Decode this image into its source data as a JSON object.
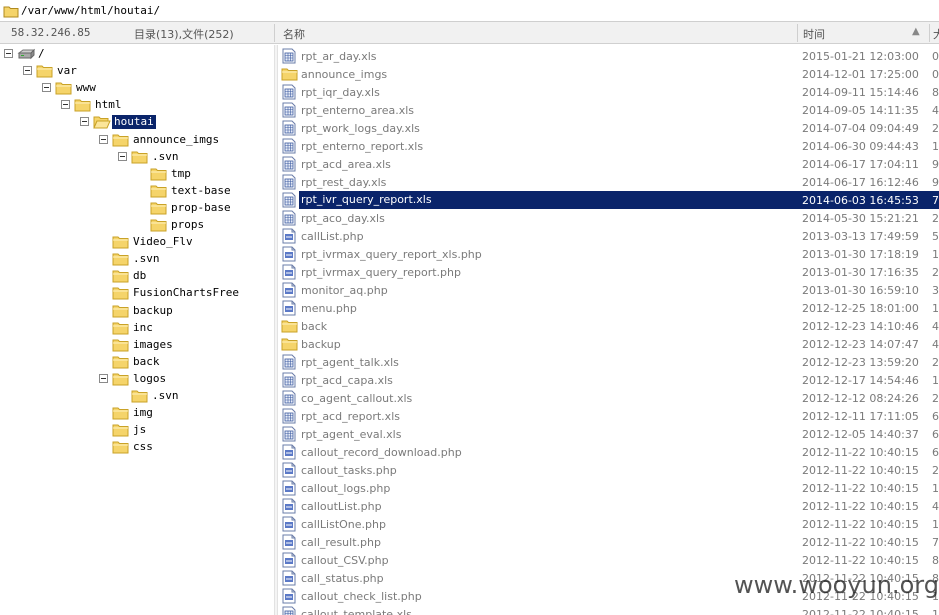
{
  "address_bar": {
    "path": "/var/www/html/houtai/"
  },
  "header": {
    "ip": "58.32.246.85",
    "counts": "目录(13),文件(252)",
    "col_name": "名称",
    "col_time": "时间",
    "col_size": "大"
  },
  "tree": [
    {
      "label": "/",
      "icon": "drive-icon",
      "depth": 0,
      "expanded": true
    },
    {
      "label": "var",
      "icon": "folder-icon",
      "depth": 1,
      "expanded": true
    },
    {
      "label": "www",
      "icon": "folder-icon",
      "depth": 2,
      "expanded": true
    },
    {
      "label": "html",
      "icon": "folder-icon",
      "depth": 3,
      "expanded": true
    },
    {
      "label": "houtai",
      "icon": "folder-open-icon",
      "depth": 4,
      "expanded": true,
      "selected": true
    },
    {
      "label": "announce_imgs",
      "icon": "folder-icon",
      "depth": 5,
      "expanded": true
    },
    {
      "label": ".svn",
      "icon": "folder-icon",
      "depth": 6,
      "expanded": true
    },
    {
      "label": "tmp",
      "icon": "folder-icon",
      "depth": 7
    },
    {
      "label": "text-base",
      "icon": "folder-icon",
      "depth": 7
    },
    {
      "label": "prop-base",
      "icon": "folder-icon",
      "depth": 7
    },
    {
      "label": "props",
      "icon": "folder-icon",
      "depth": 7
    },
    {
      "label": "Video_Flv",
      "icon": "folder-icon",
      "depth": 5
    },
    {
      "label": ".svn",
      "icon": "folder-icon",
      "depth": 5
    },
    {
      "label": "db",
      "icon": "folder-icon",
      "depth": 5
    },
    {
      "label": "FusionChartsFree",
      "icon": "folder-icon",
      "depth": 5
    },
    {
      "label": "backup",
      "icon": "folder-icon",
      "depth": 5
    },
    {
      "label": "inc",
      "icon": "folder-icon",
      "depth": 5
    },
    {
      "label": "images",
      "icon": "folder-icon",
      "depth": 5
    },
    {
      "label": "back",
      "icon": "folder-icon",
      "depth": 5
    },
    {
      "label": "logos",
      "icon": "folder-icon",
      "depth": 5,
      "expanded": true
    },
    {
      "label": ".svn",
      "icon": "folder-icon",
      "depth": 6
    },
    {
      "label": "img",
      "icon": "folder-icon",
      "depth": 5
    },
    {
      "label": "js",
      "icon": "folder-icon",
      "depth": 5
    },
    {
      "label": "css",
      "icon": "folder-icon",
      "depth": 5
    }
  ],
  "files": [
    {
      "name": "rpt_ar_day.xls",
      "time": "2015-01-21 12:03:00",
      "size": "0",
      "icon": "xls-file-icon"
    },
    {
      "name": "announce_imgs",
      "time": "2014-12-01 17:25:00",
      "size": "0",
      "icon": "folder-icon"
    },
    {
      "name": "rpt_iqr_day.xls",
      "time": "2014-09-11 15:14:46",
      "size": "8",
      "icon": "xls-file-icon"
    },
    {
      "name": "rpt_enterno_area.xls",
      "time": "2014-09-05 14:11:35",
      "size": "4",
      "icon": "xls-file-icon"
    },
    {
      "name": "rpt_work_logs_day.xls",
      "time": "2014-07-04 09:04:49",
      "size": "2",
      "icon": "xls-file-icon"
    },
    {
      "name": "rpt_enterno_report.xls",
      "time": "2014-06-30 09:44:43",
      "size": "1",
      "icon": "xls-file-icon"
    },
    {
      "name": "rpt_acd_area.xls",
      "time": "2014-06-17 17:04:11",
      "size": "9",
      "icon": "xls-file-icon"
    },
    {
      "name": "rpt_rest_day.xls",
      "time": "2014-06-17 16:12:46",
      "size": "9",
      "icon": "xls-file-icon"
    },
    {
      "name": "rpt_ivr_query_report.xls",
      "time": "2014-06-03 16:45:53",
      "size": "7",
      "icon": "xls-file-icon",
      "selected": true
    },
    {
      "name": "rpt_aco_day.xls",
      "time": "2014-05-30 15:21:21",
      "size": "2",
      "icon": "xls-file-icon"
    },
    {
      "name": "callList.php",
      "time": "2013-03-13 17:49:59",
      "size": "5",
      "icon": "php-file-icon"
    },
    {
      "name": "rpt_ivrmax_query_report_xls.php",
      "time": "2013-01-30 17:18:19",
      "size": "1",
      "icon": "php-file-icon"
    },
    {
      "name": "rpt_ivrmax_query_report.php",
      "time": "2013-01-30 17:16:35",
      "size": "2",
      "icon": "php-file-icon"
    },
    {
      "name": "monitor_aq.php",
      "time": "2013-01-30 16:59:10",
      "size": "3",
      "icon": "php-file-icon"
    },
    {
      "name": "menu.php",
      "time": "2012-12-25 18:01:00",
      "size": "1",
      "icon": "php-file-icon"
    },
    {
      "name": "back",
      "time": "2012-12-23 14:10:46",
      "size": "4",
      "icon": "folder-icon"
    },
    {
      "name": "backup",
      "time": "2012-12-23 14:07:47",
      "size": "4",
      "icon": "folder-icon"
    },
    {
      "name": "rpt_agent_talk.xls",
      "time": "2012-12-23 13:59:20",
      "size": "2",
      "icon": "xls-file-icon"
    },
    {
      "name": "rpt_acd_capa.xls",
      "time": "2012-12-17 14:54:46",
      "size": "1",
      "icon": "xls-file-icon"
    },
    {
      "name": "co_agent_callout.xls",
      "time": "2012-12-12 08:24:26",
      "size": "2",
      "icon": "xls-file-icon"
    },
    {
      "name": "rpt_acd_report.xls",
      "time": "2012-12-11 17:11:05",
      "size": "6",
      "icon": "xls-file-icon"
    },
    {
      "name": "rpt_agent_eval.xls",
      "time": "2012-12-05 14:40:37",
      "size": "6",
      "icon": "xls-file-icon"
    },
    {
      "name": "callout_record_download.php",
      "time": "2012-11-22 10:40:15",
      "size": "6",
      "icon": "php-file-icon"
    },
    {
      "name": "callout_tasks.php",
      "time": "2012-11-22 10:40:15",
      "size": "2",
      "icon": "php-file-icon"
    },
    {
      "name": "callout_logs.php",
      "time": "2012-11-22 10:40:15",
      "size": "1",
      "icon": "php-file-icon"
    },
    {
      "name": "calloutList.php",
      "time": "2012-11-22 10:40:15",
      "size": "4",
      "icon": "php-file-icon"
    },
    {
      "name": "callListOne.php",
      "time": "2012-11-22 10:40:15",
      "size": "1",
      "icon": "php-file-icon"
    },
    {
      "name": "call_result.php",
      "time": "2012-11-22 10:40:15",
      "size": "7",
      "icon": "php-file-icon"
    },
    {
      "name": "callout_CSV.php",
      "time": "2012-11-22 10:40:15",
      "size": "8",
      "icon": "php-file-icon"
    },
    {
      "name": "call_status.php",
      "time": "2012-11-22 10:40:15",
      "size": "8",
      "icon": "php-file-icon"
    },
    {
      "name": "callout_check_list.php",
      "time": "2012-11-22 10:40:15",
      "size": "1",
      "icon": "php-file-icon"
    },
    {
      "name": "callout_template.xls",
      "time": "2012-11-22 10:40:15",
      "size": "1",
      "icon": "xls-file-icon"
    }
  ],
  "watermark": "www.wooyun.org",
  "colors": {
    "selection": "#0a246a",
    "folder": "#f5d46a",
    "folder_edge": "#c9a227"
  }
}
